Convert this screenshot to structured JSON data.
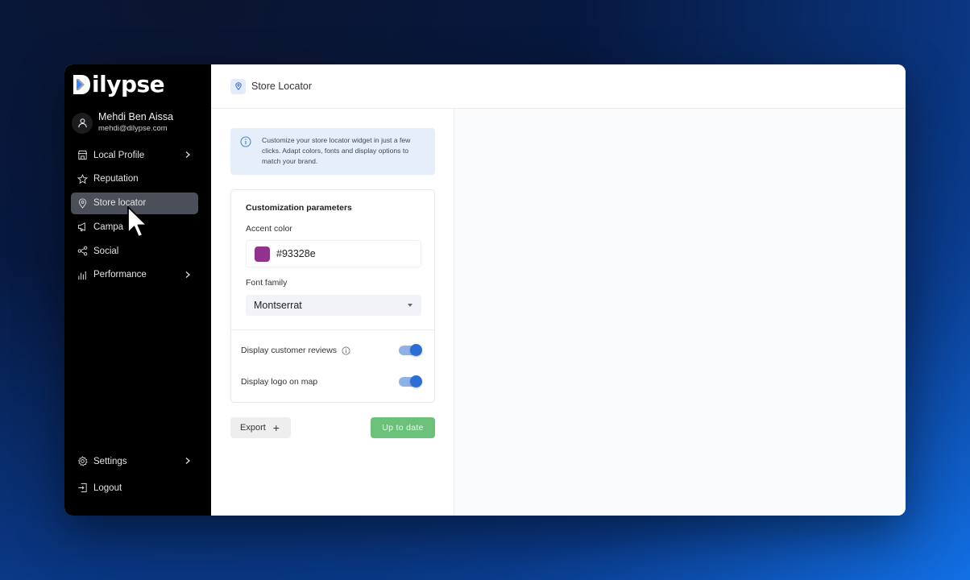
{
  "brand": {
    "logo_text": "ilypse"
  },
  "user": {
    "name": "Mehdi Ben Aissa",
    "email": "mehdi@dilypse.com"
  },
  "nav": {
    "items": [
      {
        "label": "Local Profile",
        "icon": "store-icon",
        "chevron": true
      },
      {
        "label": "Reputation",
        "icon": "star-icon",
        "chevron": false
      },
      {
        "label": "Store locator",
        "icon": "map-pin-icon",
        "chevron": false,
        "active": true
      },
      {
        "label": "Campa",
        "icon": "megaphone-icon",
        "chevron": false
      },
      {
        "label": "Social",
        "icon": "share-icon",
        "chevron": false
      },
      {
        "label": "Performance",
        "icon": "bar-chart-icon",
        "chevron": true
      }
    ],
    "bottom": [
      {
        "label": "Settings",
        "icon": "gear-icon",
        "chevron": true
      },
      {
        "label": "Logout",
        "icon": "logout-icon",
        "chevron": false
      }
    ]
  },
  "header": {
    "title": "Store Locator",
    "icon": "map-pin-icon"
  },
  "info": {
    "text": "Customize your store locator widget in just a few clicks. Adapt colors, fonts and display options to match your brand."
  },
  "customization": {
    "title": "Customization parameters",
    "accent_label": "Accent color",
    "accent_value": "#93328e",
    "font_label": "Font family",
    "font_value": "Montserrat",
    "toggles": [
      {
        "label": "Display customer reviews",
        "on": true,
        "has_info": true
      },
      {
        "label": "Display logo on map",
        "on": true,
        "has_info": false
      }
    ]
  },
  "actions": {
    "export_label": "Export",
    "status_label": "Up to date"
  },
  "colors": {
    "accent": "#93328e",
    "success": "#6cc17a",
    "toggle": "#2b6fd6",
    "brand_blue": "#3b82f6"
  }
}
